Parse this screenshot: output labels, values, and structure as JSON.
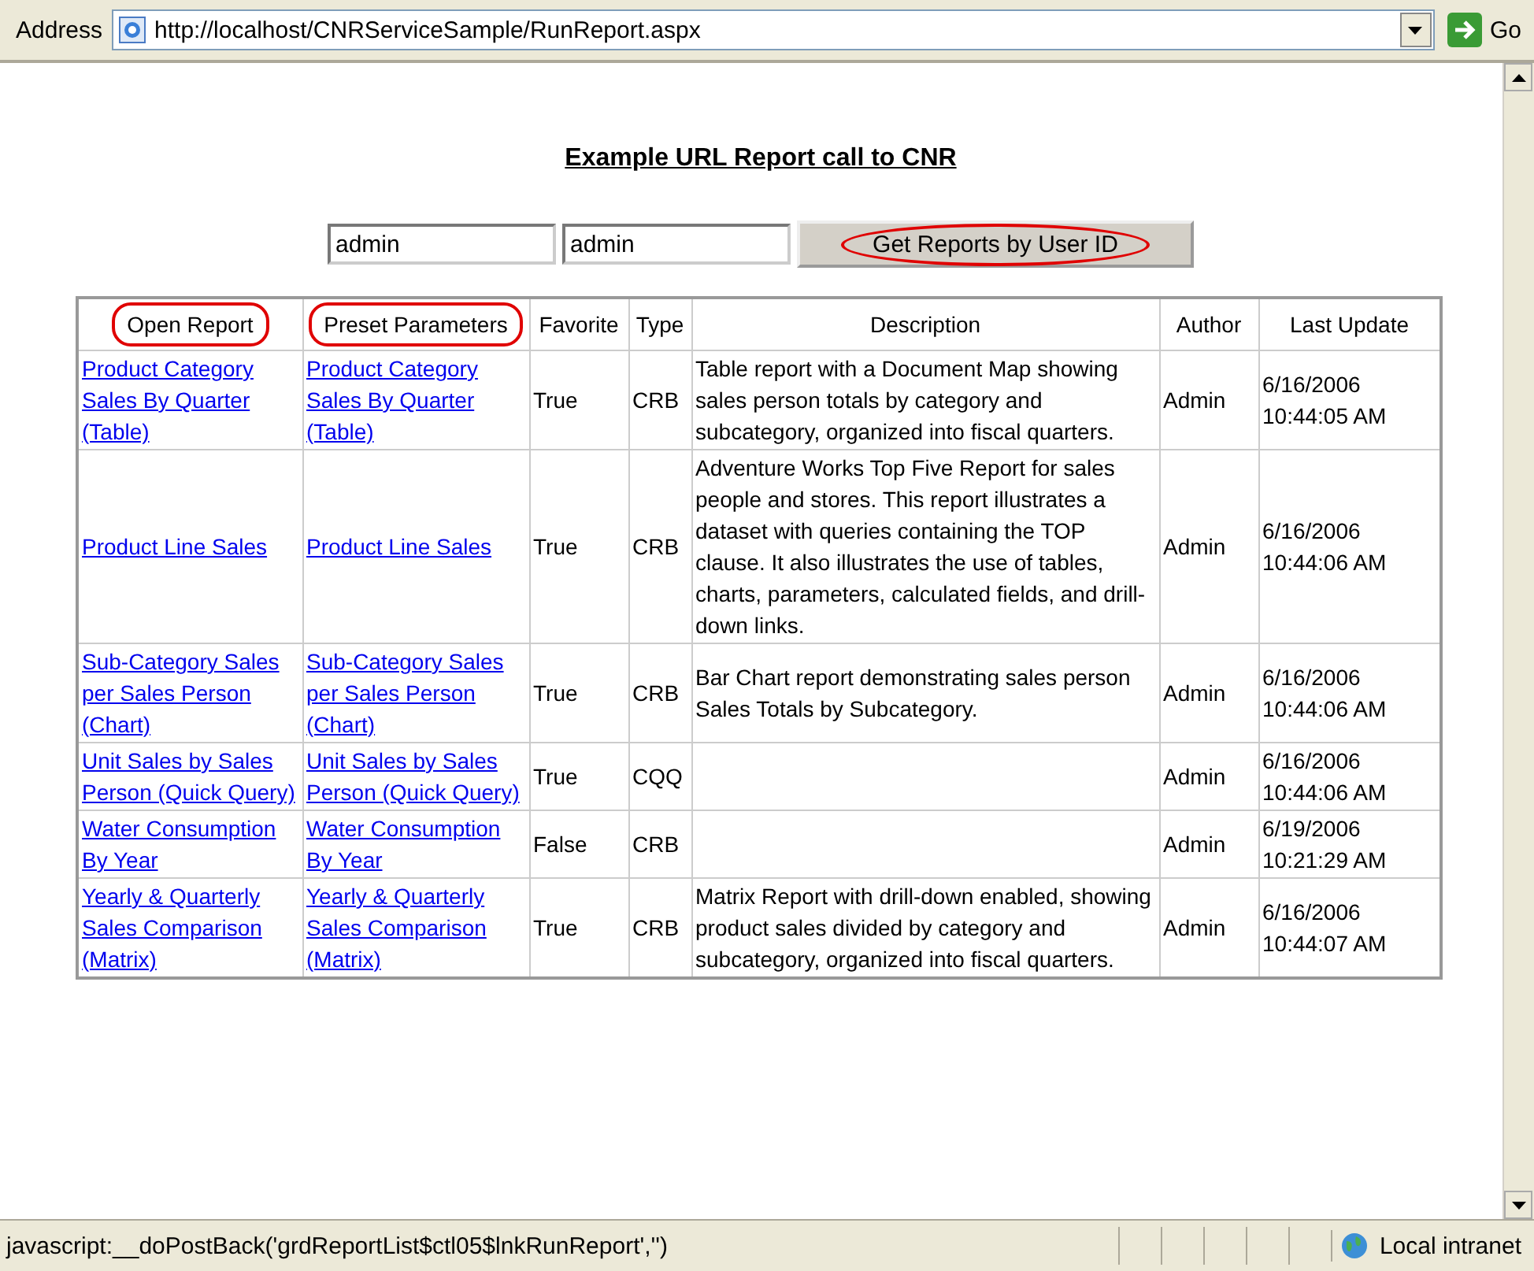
{
  "address_bar": {
    "label": "Address",
    "url": "http://localhost/CNRServiceSample/RunReport.aspx",
    "go_label": "Go"
  },
  "page": {
    "title": "Example URL Report call to CNR",
    "user_field": {
      "value": "admin"
    },
    "password_field": {
      "value": "admin"
    },
    "button": {
      "label": "Get Reports by User ID",
      "circled": true
    }
  },
  "table": {
    "columns": [
      {
        "label": "Open Report",
        "circled": true
      },
      {
        "label": "Preset Parameters",
        "circled": true
      },
      {
        "label": "Favorite",
        "circled": false
      },
      {
        "label": "Type",
        "circled": false
      },
      {
        "label": "Description",
        "circled": false
      },
      {
        "label": "Author",
        "circled": false
      },
      {
        "label": "Last Update",
        "circled": false
      }
    ],
    "rows": [
      {
        "open_report": "Product Category Sales By Quarter (Table)",
        "preset_parameters": "Product Category Sales By Quarter (Table)",
        "favorite": "True",
        "type": "CRB",
        "description": "Table report with a Document Map showing sales person totals by category and subcategory, organized into fiscal quarters.",
        "author": "Admin",
        "last_update": "6/16/2006 10:44:05 AM"
      },
      {
        "open_report": "Product Line Sales",
        "preset_parameters": "Product Line Sales",
        "favorite": "True",
        "type": "CRB",
        "description": "Adventure Works Top Five Report for sales people and stores. This report illustrates a dataset with queries containing the TOP clause. It also illustrates the use of tables, charts, parameters, calculated fields, and drill-down links.",
        "author": "Admin",
        "last_update": "6/16/2006 10:44:06 AM"
      },
      {
        "open_report": "Sub-Category Sales per Sales Person (Chart)",
        "preset_parameters": "Sub-Category Sales per Sales Person (Chart)",
        "favorite": "True",
        "type": "CRB",
        "description": "Bar Chart report demonstrating sales person Sales Totals by Subcategory.",
        "author": "Admin",
        "last_update": "6/16/2006 10:44:06 AM"
      },
      {
        "open_report": "Unit Sales by Sales Person (Quick Query)",
        "preset_parameters": "Unit Sales by Sales Person (Quick Query)",
        "favorite": "True",
        "type": "CQQ",
        "author": "Admin",
        "last_update": "6/16/2006 10:44:06 AM"
      },
      {
        "open_report": "Water Consumption By Year",
        "preset_parameters": "Water Consumption By Year",
        "favorite": "False",
        "type": "CRB",
        "author": "Admin",
        "last_update": "6/19/2006 10:21:29 AM"
      },
      {
        "open_report": "Yearly & Quarterly Sales Comparison (Matrix)",
        "preset_parameters": "Yearly & Quarterly Sales Comparison (Matrix)",
        "favorite": "True",
        "type": "CRB",
        "description": "Matrix Report with drill-down enabled, showing product sales divided by category and subcategory, organized into fiscal quarters.",
        "author": "Admin",
        "last_update": "6/16/2006 10:44:07 AM"
      }
    ]
  },
  "status_bar": {
    "text": "javascript:__doPostBack('grdReportList$ctl05$lnkRunReport','')",
    "zone": "Local intranet"
  }
}
